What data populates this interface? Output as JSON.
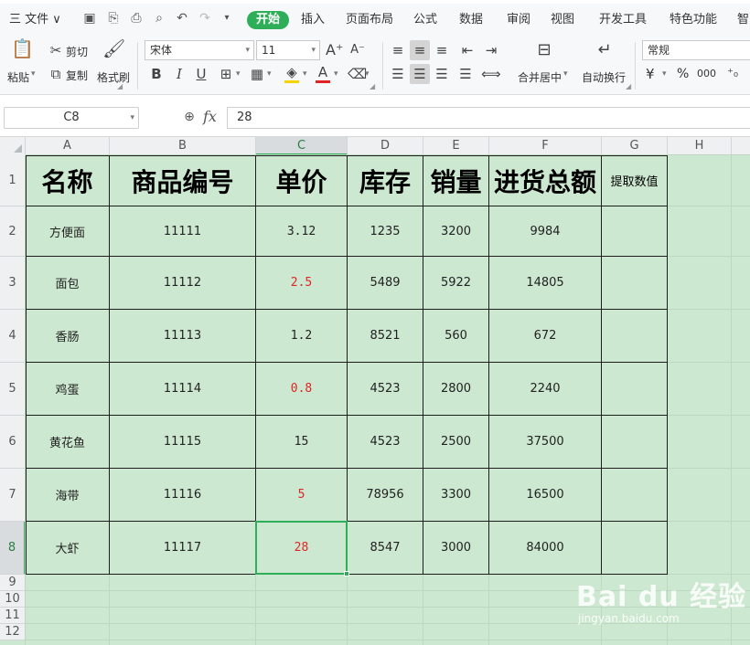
{
  "menu": {
    "file_label": "三 文件 ∨",
    "tabs": [
      "开始",
      "插入",
      "页面布局",
      "公式",
      "数据",
      "审阅",
      "视图",
      "开发工具",
      "特色功能",
      "智"
    ],
    "active_tab": "开始"
  },
  "ribbon": {
    "paste_label": "粘贴",
    "cut_label": "剪切",
    "copy_label": "复制",
    "format_painter_label": "格式刷",
    "font_name": "宋体",
    "font_size": "11",
    "merge_center_label": "合并居中",
    "wrap_text_label": "自动换行",
    "number_format": "常规",
    "currency_symbol": "¥",
    "percent_symbol": "%",
    "thousands_symbol": "000",
    "font_color": "#e02424",
    "fill_color": "#f5d400"
  },
  "formula_bar": {
    "cell_ref": "C8",
    "fx_label": "fx",
    "value": "28"
  },
  "sheet": {
    "columns": [
      "A",
      "B",
      "C",
      "D",
      "E",
      "F",
      "G",
      "H"
    ],
    "rows": [
      "1",
      "2",
      "3",
      "4",
      "5",
      "6",
      "7",
      "8",
      "9",
      "10",
      "11",
      "12"
    ],
    "selected_column": "C",
    "selected_row": "8",
    "headers": [
      "名称",
      "商品编号",
      "单价",
      "库存",
      "销量",
      "进货总额",
      "提取数值"
    ],
    "data": [
      [
        "方便面",
        "11111",
        "3.12",
        "1235",
        "3200",
        "9984",
        ""
      ],
      [
        "面包",
        "11112",
        "2.5",
        "5489",
        "5922",
        "14805",
        ""
      ],
      [
        "香肠",
        "11113",
        "1.2",
        "8521",
        "560",
        "672",
        ""
      ],
      [
        "鸡蛋",
        "11114",
        "0.8",
        "4523",
        "2800",
        "2240",
        ""
      ],
      [
        "黄花鱼",
        "11115",
        "15",
        "4523",
        "2500",
        "37500",
        ""
      ],
      [
        "海带",
        "11116",
        "5",
        "78956",
        "3300",
        "16500",
        ""
      ],
      [
        "大虾",
        "11117",
        "28",
        "8547",
        "3000",
        "84000",
        ""
      ]
    ],
    "cell_fill_color": "#cde8d0",
    "red_price_color": "#e02424"
  },
  "watermark": {
    "brand": "Bai du 经验",
    "url": "jingyan.baidu.com"
  }
}
